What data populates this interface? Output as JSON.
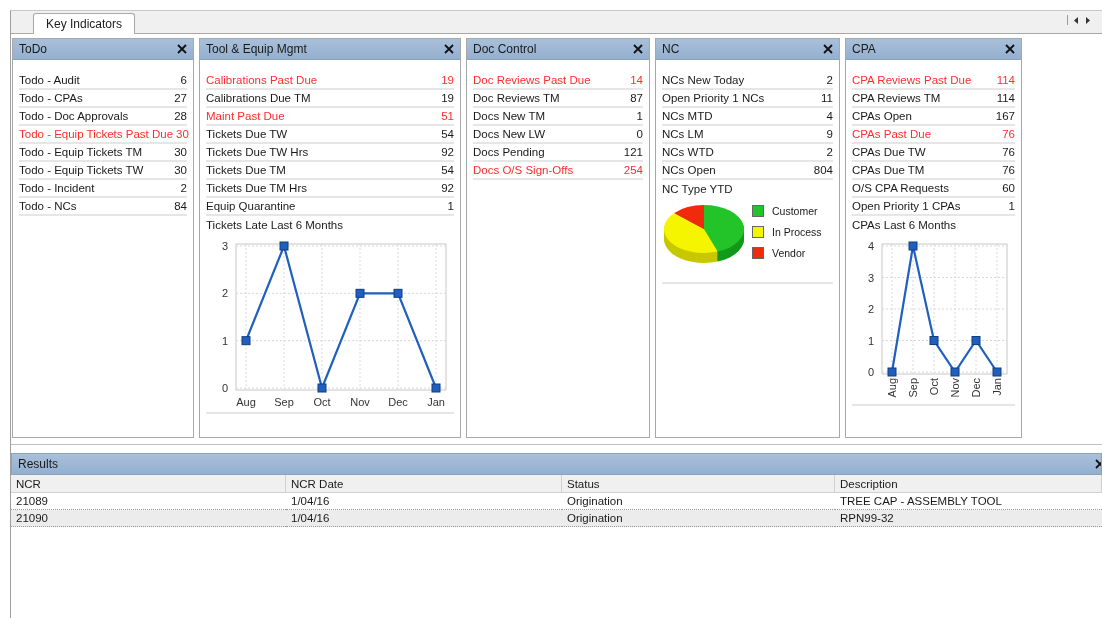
{
  "tabs": [
    {
      "label": "Key Indicators",
      "selected": true
    }
  ],
  "panels": [
    {
      "title": "ToDo",
      "items": [
        {
          "label": "Todo - Audit",
          "value": "6",
          "alert": false
        },
        {
          "label": "Todo - CPAs",
          "value": "27",
          "alert": false
        },
        {
          "label": "Todo - Doc Approvals",
          "value": "28",
          "alert": false
        },
        {
          "label": "Todo - Equip Tickets Past Due",
          "value": "30",
          "alert": true
        },
        {
          "label": "Todo - Equip Tickets TM",
          "value": "30",
          "alert": false
        },
        {
          "label": "Todo - Equip Tickets TW",
          "value": "30",
          "alert": false
        },
        {
          "label": "Todo - Incident",
          "value": "2",
          "alert": false
        },
        {
          "label": "Todo - NCs",
          "value": "84",
          "alert": false
        }
      ]
    },
    {
      "title": "Tool & Equip Mgmt",
      "items": [
        {
          "label": "Calibrations Past Due",
          "value": "19",
          "alert": true
        },
        {
          "label": "Calibrations Due TM",
          "value": "19",
          "alert": false
        },
        {
          "label": "Maint Past Due",
          "value": "51",
          "alert": true
        },
        {
          "label": "Tickets Due TW",
          "value": "54",
          "alert": false
        },
        {
          "label": "Tickets Due TW Hrs",
          "value": "92",
          "alert": false
        },
        {
          "label": "Tickets Due TM",
          "value": "54",
          "alert": false
        },
        {
          "label": "Tickets Due TM Hrs",
          "value": "92",
          "alert": false
        },
        {
          "label": "Equip Quarantine",
          "value": "1",
          "alert": false
        }
      ],
      "chart_data": {
        "type": "line",
        "title": "Tickets Late Last 6 Months",
        "categories": [
          "Aug",
          "Sep",
          "Oct",
          "Nov",
          "Dec",
          "Jan"
        ],
        "series": [
          {
            "color": "#1f5fbf",
            "marker": "square",
            "values": [
              1,
              3,
              0,
              2,
              2,
              0
            ]
          }
        ],
        "grid": true,
        "ylim": [
          0,
          3
        ],
        "yticks": [
          0,
          1,
          2,
          3
        ]
      }
    },
    {
      "title": "Doc Control",
      "items": [
        {
          "label": "Doc Reviews Past Due",
          "value": "14",
          "alert": true
        },
        {
          "label": "Doc Reviews TM",
          "value": "87",
          "alert": false
        },
        {
          "label": "Docs New TM",
          "value": "1",
          "alert": false
        },
        {
          "label": "Docs New LW",
          "value": "0",
          "alert": false
        },
        {
          "label": "Docs Pending",
          "value": "121",
          "alert": false
        },
        {
          "label": "Docs O/S Sign-Offs",
          "value": "254",
          "alert": true
        }
      ]
    },
    {
      "title": "NC",
      "items": [
        {
          "label": "NCs New Today",
          "value": "2",
          "alert": false
        },
        {
          "label": "Open Priority 1 NCs",
          "value": "11",
          "alert": false
        },
        {
          "label": "NCs MTD",
          "value": "4",
          "alert": false
        },
        {
          "label": "NCs LM",
          "value": "9",
          "alert": false
        },
        {
          "label": "NCs WTD",
          "value": "2",
          "alert": false
        },
        {
          "label": "NCs Open",
          "value": "804",
          "alert": false
        }
      ],
      "pie": {
        "title": "NC Type YTD",
        "legend": [
          {
            "label": "Customer",
            "color": "#22c42a"
          },
          {
            "label": "In Process",
            "color": "#f5f500"
          },
          {
            "label": "Vendor",
            "color": "#f02a0a"
          }
        ]
      }
    },
    {
      "title": "CPA",
      "items": [
        {
          "label": "CPA Reviews Past Due",
          "value": "114",
          "alert": true
        },
        {
          "label": "CPA Reviews TM",
          "value": "114",
          "alert": false
        },
        {
          "label": "CPAs Open",
          "value": "167",
          "alert": false
        },
        {
          "label": "CPAs Past Due",
          "value": "76",
          "alert": true
        },
        {
          "label": "CPAs Due TW",
          "value": "76",
          "alert": false
        },
        {
          "label": "CPAs Due TM",
          "value": "76",
          "alert": false
        },
        {
          "label": "O/S CPA Requests",
          "value": "60",
          "alert": false
        },
        {
          "label": "Open Priority 1 CPAs",
          "value": "1",
          "alert": false
        }
      ],
      "chart_data": {
        "type": "line",
        "title": "CPAs Last 6 Months",
        "categories": [
          "Aug",
          "Sep",
          "Oct",
          "Nov",
          "Dec",
          "Jan"
        ],
        "series": [
          {
            "color": "#1f5fbf",
            "marker": "square",
            "values": [
              0,
              4,
              1,
              0,
              1,
              0
            ]
          }
        ],
        "grid": true,
        "ylim": [
          0,
          4
        ],
        "yticks": [
          0,
          1,
          2,
          3,
          4
        ]
      }
    }
  ],
  "results": {
    "title": "Results",
    "columns": [
      "NCR",
      "NCR Date",
      "Status",
      "Description"
    ],
    "rows": [
      {
        "cells": [
          "21089",
          "1/04/16",
          "Origination",
          "TREE CAP - ASSEMBLY TOOL"
        ],
        "selected": false
      },
      {
        "cells": [
          "21090",
          "1/04/16",
          "Origination",
          "RPN99-32"
        ],
        "selected": true
      }
    ]
  }
}
